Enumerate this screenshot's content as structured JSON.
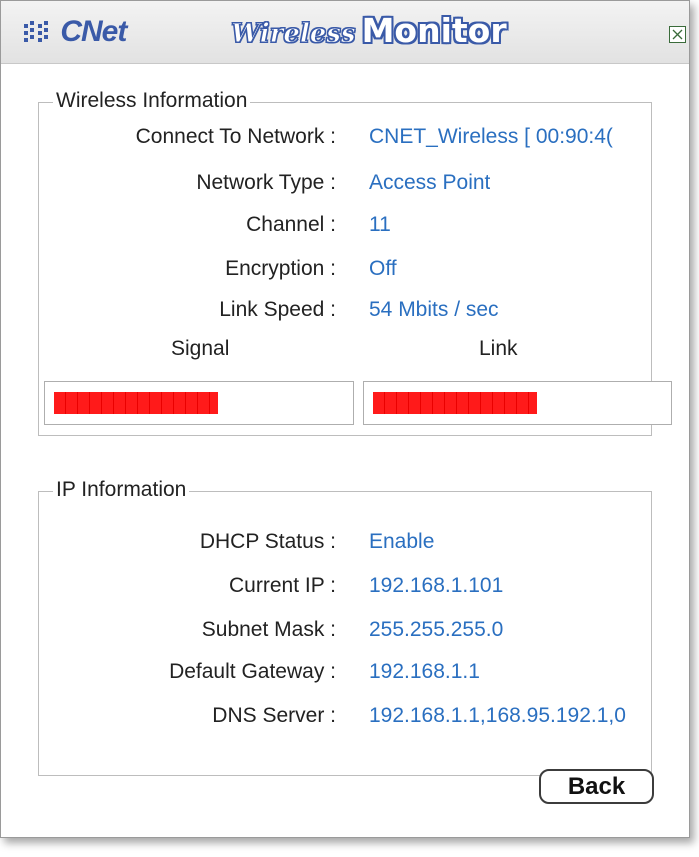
{
  "titlebar": {
    "logo": "CNet",
    "title_part1": "Wireless",
    "title_part2": "Monitor"
  },
  "wireless": {
    "legend": "Wireless Information",
    "rows": [
      {
        "label": "Connect To Network :",
        "value": "CNET_Wireless [ 00:90:4("
      },
      {
        "label": "Network Type :",
        "value": "Access Point"
      },
      {
        "label": "Channel :",
        "value": "11"
      },
      {
        "label": "Encryption :",
        "value": "Off"
      },
      {
        "label": "Link Speed :",
        "value": "54 Mbits / sec"
      }
    ],
    "signal_label": "Signal",
    "link_label": "Link",
    "signal_level": 0.57,
    "link_level": 0.57
  },
  "ip": {
    "legend": "IP Information",
    "rows": [
      {
        "label": "DHCP Status :",
        "value": "Enable"
      },
      {
        "label": "Current IP :",
        "value": "192.168.1.101"
      },
      {
        "label": "Subnet Mask :",
        "value": "255.255.255.0"
      },
      {
        "label": "Default Gateway :",
        "value": "192.168.1.1"
      },
      {
        "label": "DNS Server :",
        "value": "192.168.1.1,168.95.192.1,0"
      }
    ]
  },
  "back_label": "Back",
  "colors": {
    "accent": "#3a5aa8",
    "value_text": "#2a6fc0",
    "meter": "#ff1a1a"
  },
  "icons": {
    "close": "close-x-icon",
    "logo_mark": "cnet-logo-icon"
  }
}
